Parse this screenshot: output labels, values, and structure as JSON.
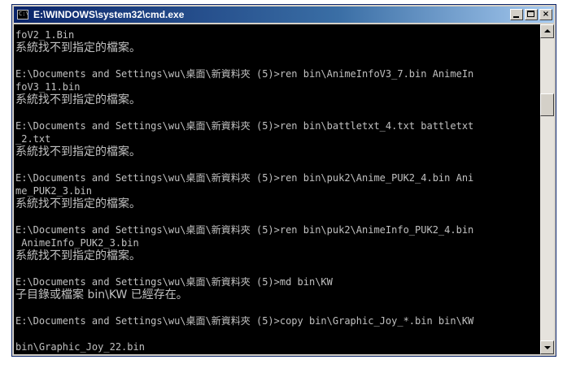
{
  "window": {
    "title": "E:\\WINDOWS\\system32\\cmd.exe",
    "icon_name": "cmd-icon",
    "icon_text": "C:\\",
    "controls": {
      "minimize": "minimize-icon",
      "maximize": "maximize-icon",
      "close": "×"
    }
  },
  "console": {
    "lines": [
      "foV2_1.Bin",
      "系統找不到指定的檔案。",
      "",
      "E:\\Documents and Settings\\wu\\桌面\\新資料夾 (5)>ren bin\\AnimeInfoV3_7.bin AnimeIn",
      "foV3_11.bin",
      "系統找不到指定的檔案。",
      "",
      "E:\\Documents and Settings\\wu\\桌面\\新資料夾 (5)>ren bin\\battletxt_4.txt battletxt",
      "_2.txt",
      "系統找不到指定的檔案。",
      "",
      "E:\\Documents and Settings\\wu\\桌面\\新資料夾 (5)>ren bin\\puk2\\Anime_PUK2_4.bin Ani",
      "me_PUK2_3.bin",
      "系統找不到指定的檔案。",
      "",
      "E:\\Documents and Settings\\wu\\桌面\\新資料夾 (5)>ren bin\\puk2\\AnimeInfo_PUK2_4.bin",
      " AnimeInfo_PUK2_3.bin",
      "系統找不到指定的檔案。",
      "",
      "E:\\Documents and Settings\\wu\\桌面\\新資料夾 (5)>md bin\\KW",
      "子目錄或檔案 bin\\KW 已經存在。",
      "",
      "E:\\Documents and Settings\\wu\\桌面\\新資料夾 (5)>copy bin\\Graphic_Joy_*.bin bin\\KW",
      "",
      "bin\\Graphic_Joy_22.bin"
    ]
  },
  "colors": {
    "console_bg": "#000000",
    "console_fg": "#c0c0c0",
    "titlebar_start": "#0a246a",
    "titlebar_end": "#a6caf0"
  },
  "scrollbar": {
    "up": "scroll-up-arrow-icon",
    "down": "scroll-down-arrow-icon"
  }
}
